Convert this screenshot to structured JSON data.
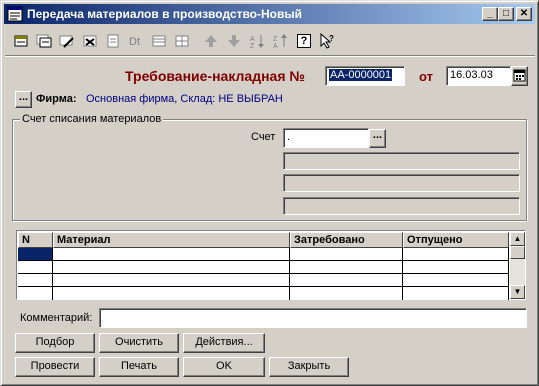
{
  "window": {
    "title": "Передача материалов в производство-Новый",
    "minimize_glyph": "_",
    "maximize_glyph": "□",
    "close_glyph": "✕"
  },
  "toolbar": {
    "tools": [
      "new-row-icon",
      "copy-row-icon",
      "edit-row-icon",
      "delete-row-icon",
      "mark-delete-icon",
      "post-icon",
      "sort-icon",
      "table-icon",
      "move-up-icon",
      "move-down-icon",
      "sort-ascending-icon",
      "sort-descending-icon",
      "help-icon",
      "context-help-icon"
    ],
    "help_glyph": "?"
  },
  "header": {
    "doc_title": "Требование-накладная №",
    "doc_number": "АА-0000001",
    "date_label": "от",
    "date": "16.03.03"
  },
  "firm": {
    "button_glyph": "...",
    "label": "Фирма:",
    "value_prefix": "Основная фирма, Склад:",
    "value_warehouse": "НЕ ВЫБРАН"
  },
  "writeoff": {
    "group_title": "Счет списания материалов",
    "account_label": "Счет",
    "account_value": ".",
    "account_button": "..."
  },
  "table": {
    "columns": [
      "N",
      "Материал",
      "Затребовано",
      "Отпущено"
    ],
    "row_count": 4
  },
  "comment": {
    "label": "Комментарий:",
    "value": ""
  },
  "buttons": {
    "podbor": "Подбор",
    "clear": "Очистить",
    "actions": "Действия...",
    "post": "Провести",
    "print": "Печать",
    "ok": "OK",
    "close": "Закрыть"
  },
  "colors": {
    "title_accent": "#800000",
    "firm_value": "#000080",
    "titlebar_start": "#0a246a",
    "titlebar_end": "#a6caf0"
  }
}
